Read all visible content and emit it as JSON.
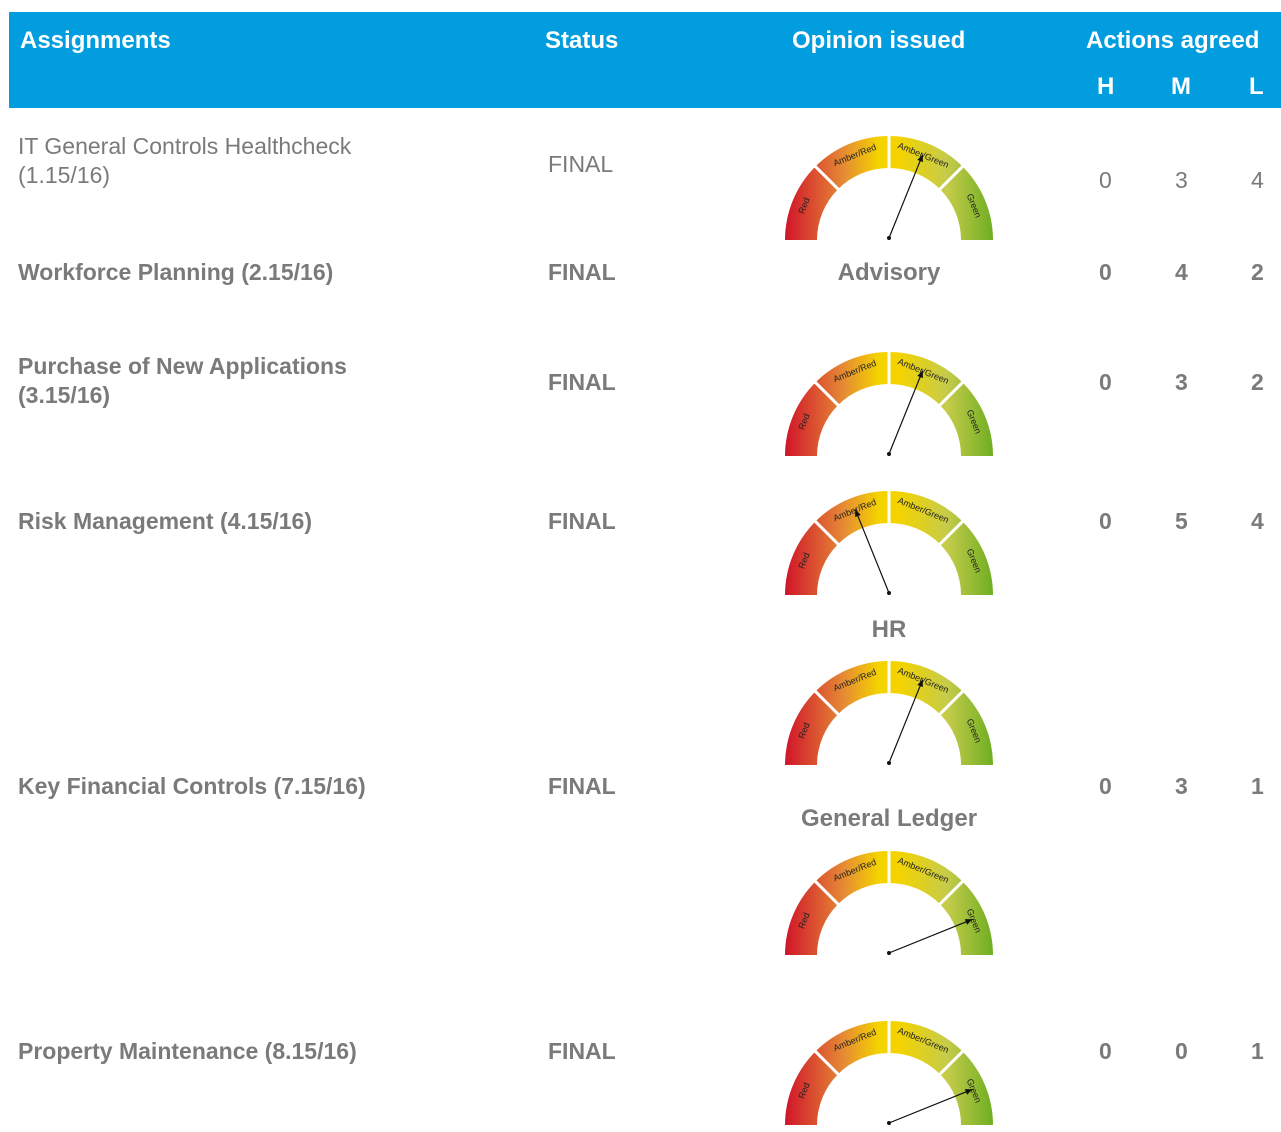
{
  "header": {
    "assignments": "Assignments",
    "status": "Status",
    "opinion": "Opinion issued",
    "actions": "Actions agreed",
    "h": "H",
    "m": "M",
    "l": "L"
  },
  "gauge_labels": {
    "red": "Red",
    "amber_red": "Amber/Red",
    "amber_green": "Amber/Green",
    "green": "Green"
  },
  "rows": [
    {
      "name": "IT General Controls Healthcheck",
      "name2": "(1.15/16)",
      "status": "FINAL",
      "opinion": {
        "type": "gauge",
        "needle_angle_deg": 22
      },
      "h": "0",
      "m": "3",
      "l": "4"
    },
    {
      "name": "Workforce Planning (2.15/16)",
      "status": "FINAL",
      "opinion": {
        "type": "text",
        "text": "Advisory"
      },
      "h": "0",
      "m": "4",
      "l": "2"
    },
    {
      "name": "Purchase of New Applications",
      "name2": "(3.15/16)",
      "status": "FINAL",
      "opinion": {
        "type": "gauge",
        "needle_angle_deg": 22
      },
      "h": "0",
      "m": "3",
      "l": "2"
    },
    {
      "name": "Risk Management (4.15/16)",
      "status": "FINAL",
      "opinion": {
        "type": "gauge",
        "needle_angle_deg": -22
      },
      "h": "0",
      "m": "5",
      "l": "4"
    },
    {
      "name": "Key Financial Controls (7.15/16)",
      "status": "FINAL",
      "opinions": [
        {
          "label": "HR",
          "needle_angle_deg": 22
        },
        {
          "label": "General Ledger",
          "needle_angle_deg": 68
        }
      ],
      "h": "0",
      "m": "3",
      "l": "1"
    },
    {
      "name": "Property Maintenance (8.15/16)",
      "status": "FINAL",
      "opinion": {
        "type": "gauge",
        "needle_angle_deg": 68
      },
      "h": "0",
      "m": "0",
      "l": "1"
    }
  ],
  "colors": {
    "header_bg": "#029ddf",
    "text_grey": "#7a7a7a",
    "red": "#d21f26",
    "amber": "#f5d200",
    "green": "#78b42a"
  }
}
